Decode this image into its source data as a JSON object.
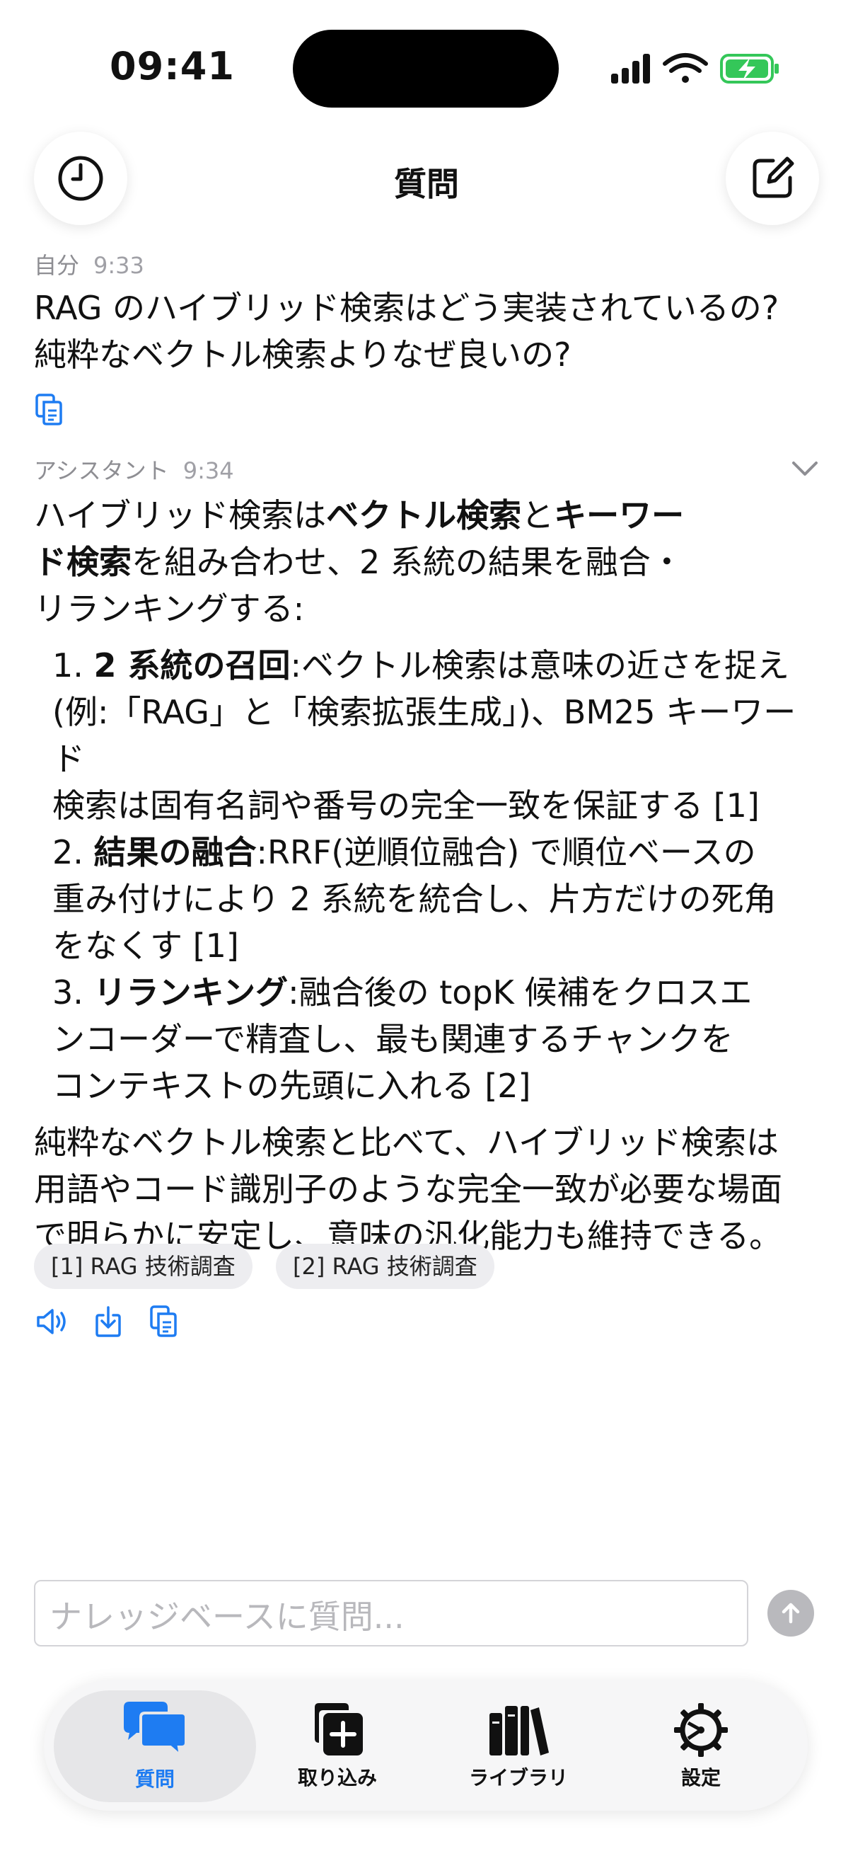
{
  "status": {
    "time": "09:41"
  },
  "header": {
    "title": "質問",
    "history_icon": "clock-icon",
    "compose_icon": "compose-icon"
  },
  "user_message": {
    "sender": "自分",
    "time": "9:33",
    "lines": [
      "RAG のハイブリッド検索はどう実装されているの?",
      "純粋なベクトル検索よりなぜ良いの?"
    ]
  },
  "assistant_message": {
    "sender": "アシスタント",
    "time": "9:34",
    "intro": {
      "t1": "ハイブリッド検索は",
      "b1": "ベクトル検索",
      "t2": "と",
      "b2a": "キーワー",
      "b2b": "ド検索",
      "t3": "を組み合わせ、2 系統の結果を融合・",
      "t4": "リランキングする:"
    },
    "list": [
      {
        "num": "1. ",
        "title": "2 系統の召回",
        "lines": [
          ":ベクトル検索は意味の近さを捉え",
          "(例:「RAG」と「検索拡張生成」)、BM25 キーワード",
          "検索は固有名詞や番号の完全一致を保証する [1]"
        ]
      },
      {
        "num": "2. ",
        "title": "結果の融合",
        "lines": [
          ":RRF(逆順位融合) で順位ベースの",
          "重み付けにより 2 系統を統合し、片方だけの死角",
          "をなくす [1]"
        ]
      },
      {
        "num": "3. ",
        "title": "リランキング",
        "lines": [
          ":融合後の topK 候補をクロスエ",
          "ンコーダーで精査し、最も関連するチャンクを",
          "コンテキストの先頭に入れる [2]"
        ]
      }
    ],
    "conclusion": [
      "純粋なベクトル検索と比べて、ハイブリッド検索は",
      "用語やコード識別子のような完全一致が必要な場面",
      "で明らかに安定し、意味の汎化能力も維持できる。"
    ],
    "citations": [
      "[1] RAG 技術調査",
      "[2] RAG 技術調査"
    ]
  },
  "composer": {
    "placeholder": "ナレッジベースに質問..."
  },
  "tabs": [
    {
      "label": "質問",
      "icon": "chat-bubbles-icon",
      "active": true
    },
    {
      "label": "取り込み",
      "icon": "add-document-icon",
      "active": false
    },
    {
      "label": "ライブラリ",
      "icon": "library-icon",
      "active": false
    },
    {
      "label": "設定",
      "icon": "gear-icon",
      "active": false
    }
  ],
  "colors": {
    "accent": "#1e7cf2",
    "battery": "#34c759"
  }
}
